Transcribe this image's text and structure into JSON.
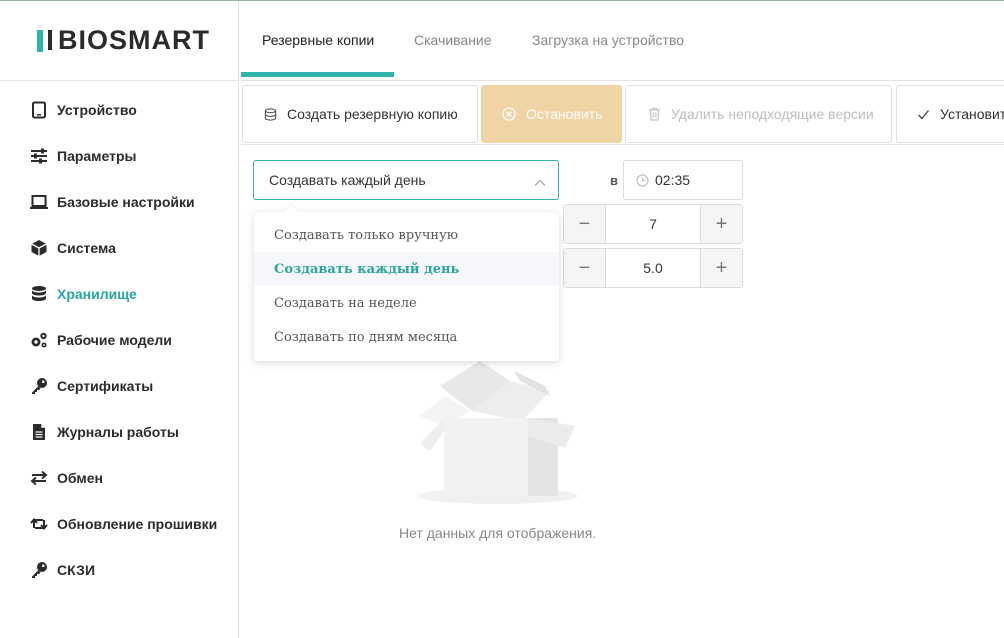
{
  "sidebar": {
    "logo_text": "BIOSMART",
    "items": [
      {
        "label": "Устройство",
        "icon": "tablet-icon"
      },
      {
        "label": "Параметры",
        "icon": "sliders-icon"
      },
      {
        "label": "Базовые настройки",
        "icon": "laptop-icon"
      },
      {
        "label": "Система",
        "icon": "cube-icon"
      },
      {
        "label": "Хранилище",
        "icon": "database-icon",
        "active": true
      },
      {
        "label": "Рабочие модели",
        "icon": "gears-icon"
      },
      {
        "label": "Сертификаты",
        "icon": "key-icon"
      },
      {
        "label": "Журналы работы",
        "icon": "file-icon"
      },
      {
        "label": "Обмен",
        "icon": "exchange-icon"
      },
      {
        "label": "Обновление прошивки",
        "icon": "retweet-icon"
      },
      {
        "label": "СКЗИ",
        "icon": "key-icon"
      }
    ]
  },
  "tabs": [
    {
      "label": "Резервные копии",
      "active": true
    },
    {
      "label": "Скачивание"
    },
    {
      "label": "Загрузка на устройство"
    }
  ],
  "toolbar": {
    "create_label": "Создать резервную копию",
    "stop_label": "Остановить",
    "delete_label": "Удалить неподходящие версии",
    "install_label": "Установить"
  },
  "form": {
    "schedule_value": "Создавать каждый день",
    "at_label": "в",
    "time_value": "02:35",
    "count_value": "7",
    "size_value": "5.0"
  },
  "dropdown": {
    "options": [
      {
        "label": "Создавать только вручную"
      },
      {
        "label": "Создавать каждый день",
        "selected": true
      },
      {
        "label": "Создавать на неделе"
      },
      {
        "label": "Создавать по дням месяца"
      }
    ]
  },
  "empty": {
    "text": "Нет данных для отображения."
  },
  "colors": {
    "accent": "#2fb3ad",
    "active_text": "#2aa69e",
    "warn_button": "#f0d4a5"
  }
}
